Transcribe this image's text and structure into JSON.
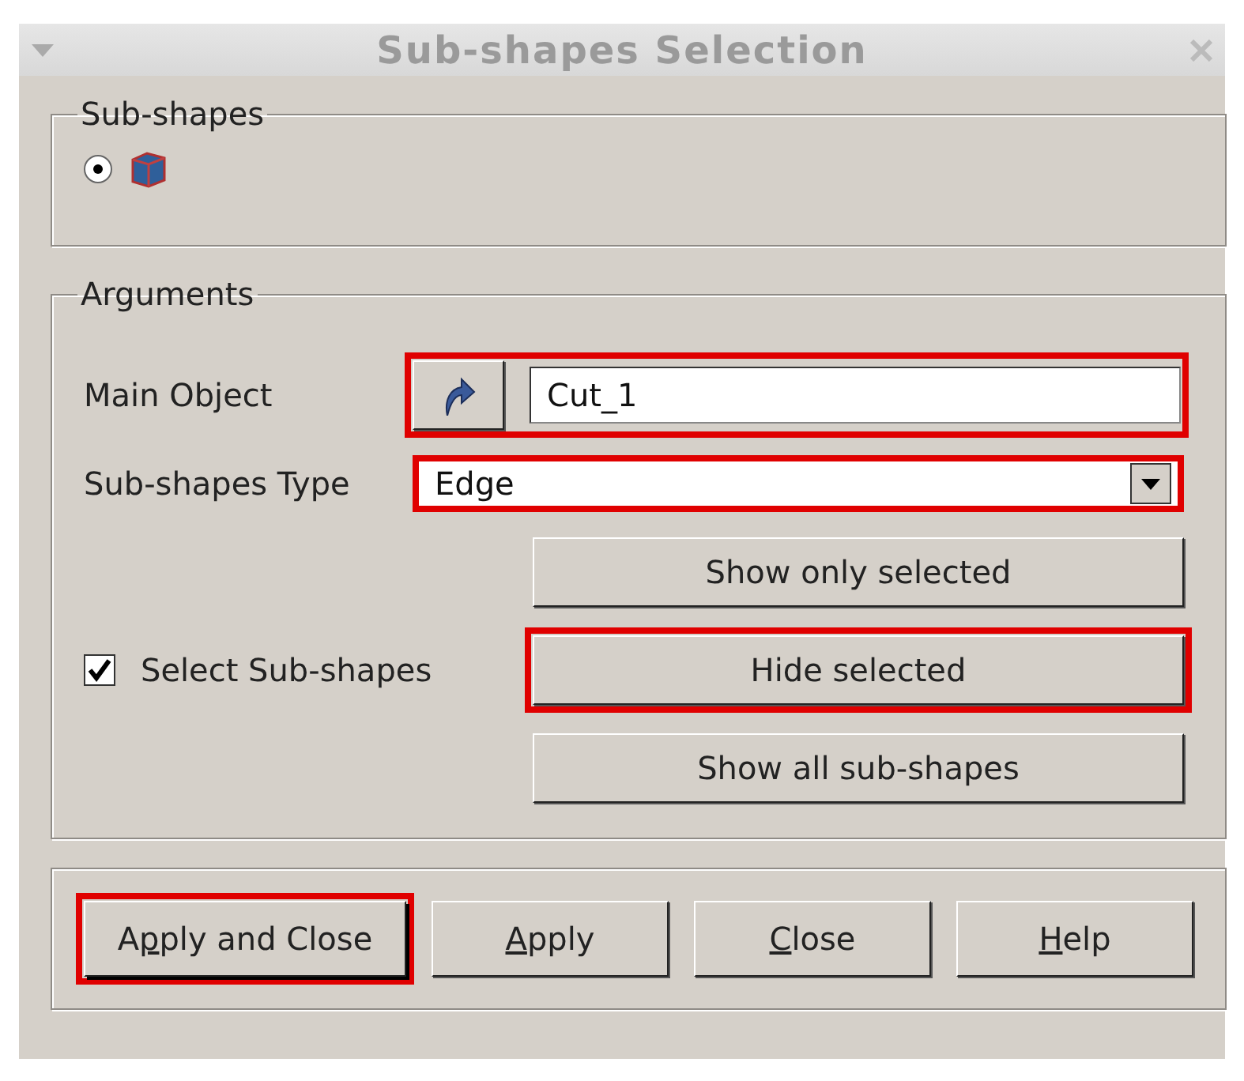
{
  "window": {
    "title": "Sub-shapes Selection"
  },
  "subshapes_group": {
    "title": "Sub-shapes",
    "options": [
      {
        "selected": true
      }
    ]
  },
  "arguments_group": {
    "title": "Arguments",
    "main_object": {
      "label": "Main Object",
      "value": "Cut_1",
      "highlighted": true
    },
    "type": {
      "label": "Sub-shapes Type",
      "value": "Edge",
      "highlighted": true
    },
    "select_subshapes": {
      "label": "Select Sub-shapes",
      "checked": true
    },
    "actions": [
      {
        "label": "Show only selected",
        "highlighted": false
      },
      {
        "label": "Hide selected",
        "highlighted": true
      },
      {
        "label": "Show all sub-shapes",
        "highlighted": false
      }
    ]
  },
  "buttons": [
    {
      "before": "A",
      "key": "p",
      "after": "ply and Close",
      "highlighted": true,
      "default": true
    },
    {
      "key": "A",
      "after": "pply",
      "highlighted": false,
      "default": false
    },
    {
      "key": "C",
      "after": "lose",
      "highlighted": false,
      "default": false
    },
    {
      "key": "H",
      "after": "elp",
      "highlighted": false,
      "default": false
    }
  ]
}
